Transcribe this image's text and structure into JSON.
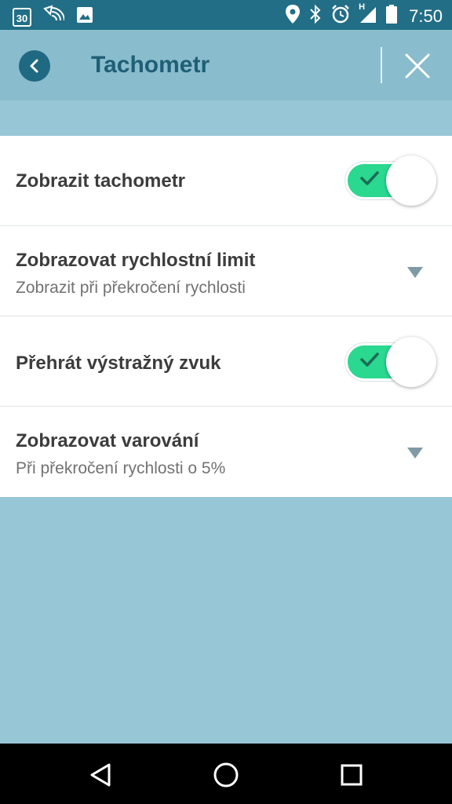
{
  "status_bar": {
    "calendar_day": "30",
    "time": "7:50",
    "network_type": "H",
    "icons": [
      "calendar-icon",
      "cast-icon",
      "image-icon",
      "location-icon",
      "bluetooth-icon",
      "alarm-icon",
      "signal-icon",
      "battery-icon"
    ]
  },
  "header": {
    "title": "Tachometr",
    "back_icon": "chevron-left-icon",
    "close_icon": "close-icon"
  },
  "settings": [
    {
      "label": "Zobrazit tachometr",
      "type": "toggle",
      "on": true
    },
    {
      "label": "Zobrazovat rychlostní limit",
      "value": "Zobrazit při překročení rychlosti",
      "type": "dropdown"
    },
    {
      "label": "Přehrát výstražný zvuk",
      "type": "toggle",
      "on": true
    },
    {
      "label": "Zobrazovat varování",
      "value": "Při překročení rychlosti o 5%",
      "type": "dropdown"
    }
  ],
  "nav_bar": {
    "icons": [
      "back-triangle-icon",
      "home-circle-icon",
      "recents-square-icon"
    ]
  },
  "colors": {
    "status_bar": "#226e86",
    "app_bar": "#89bccd",
    "background": "#97c6d6",
    "title": "#1f5f76",
    "toggle_on": "#2ad88f",
    "check": "#1b6b57"
  }
}
